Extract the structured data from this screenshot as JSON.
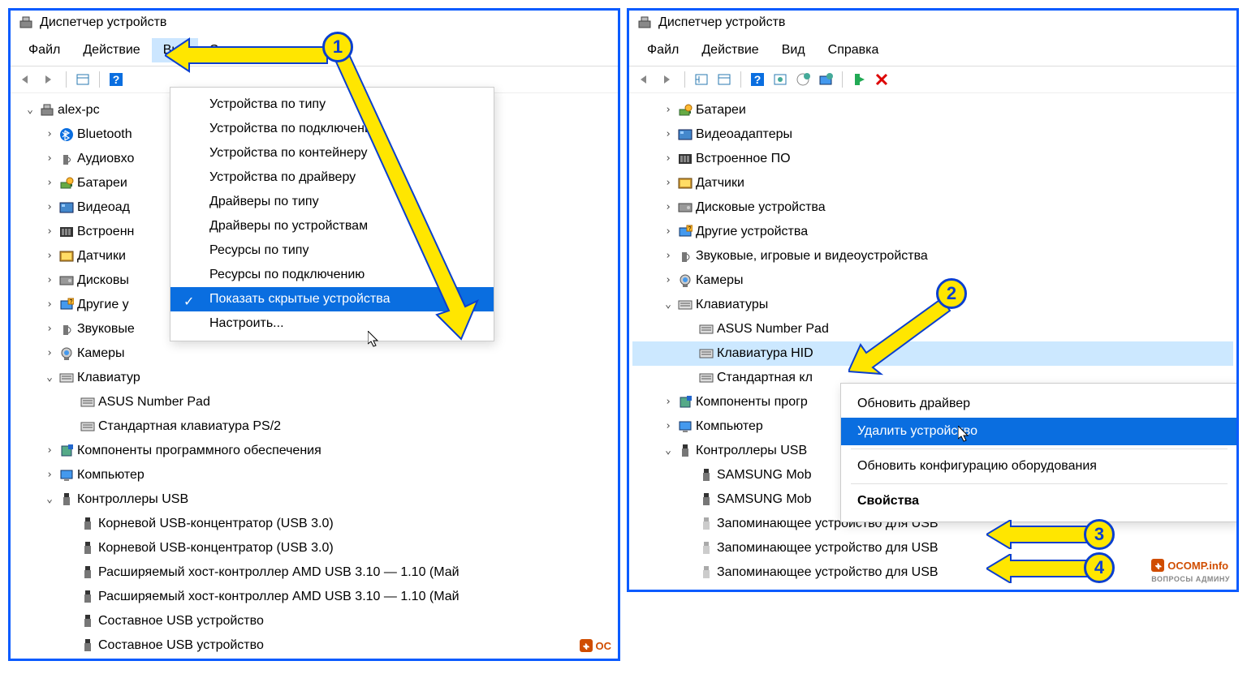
{
  "left": {
    "title": "Диспетчер устройств",
    "menu": {
      "file": "Файл",
      "action": "Действие",
      "view": "Вид",
      "help": "Справка"
    },
    "dropdown": {
      "items": [
        "Устройства по типу",
        "Устройства по подключению",
        "Устройства по контейнеру",
        "Устройства по драйверу",
        "Драйверы по типу",
        "Драйверы по устройствам",
        "Ресурсы по типу",
        "Ресурсы по подключению",
        "Показать скрытые устройства",
        "Настроить..."
      ],
      "selected": 8
    },
    "tree": {
      "root": "alex-pc",
      "items": [
        {
          "icon": "bluetooth",
          "label": "Bluetooth",
          "exp": ">"
        },
        {
          "icon": "audio-in",
          "label": "Аудиовхо",
          "exp": ">"
        },
        {
          "icon": "battery",
          "label": "Батареи",
          "exp": ">"
        },
        {
          "icon": "video",
          "label": "Видеоад",
          "exp": ">"
        },
        {
          "icon": "firmware",
          "label": "Встроенн",
          "exp": ">"
        },
        {
          "icon": "sensor",
          "label": "Датчики",
          "exp": ">"
        },
        {
          "icon": "disk",
          "label": "Дисковы",
          "exp": ">"
        },
        {
          "icon": "other",
          "label": "Другие у",
          "exp": ">"
        },
        {
          "icon": "sound",
          "label": "Звуковые",
          "exp": ">"
        },
        {
          "icon": "camera",
          "label": "Камеры",
          "exp": ">"
        }
      ],
      "keyboards": {
        "label": "Клавиатур",
        "children": [
          "ASUS Number Pad",
          "Стандартная клавиатура PS/2"
        ]
      },
      "software": "Компоненты программного обеспечения",
      "computer": "Компьютер",
      "usb": {
        "label": "Контроллеры USB",
        "children": [
          "Корневой USB-концентратор (USB 3.0)",
          "Корневой USB-концентратор (USB 3.0)",
          "Расширяемый хост-контроллер AMD USB 3.10 — 1.10 (Май",
          "Расширяемый хост-контроллер AMD USB 3.10 — 1.10 (Май",
          "Составное USB устройство",
          "Составное USB устройство"
        ]
      }
    }
  },
  "right": {
    "title": "Диспетчер устройств",
    "menu": {
      "file": "Файл",
      "action": "Действие",
      "view": "Вид",
      "help": "Справка"
    },
    "tree": {
      "items": [
        {
          "icon": "battery",
          "label": "Батареи",
          "exp": ">"
        },
        {
          "icon": "video",
          "label": "Видеоадаптеры",
          "exp": ">"
        },
        {
          "icon": "firmware",
          "label": "Встроенное ПО",
          "exp": ">"
        },
        {
          "icon": "sensor",
          "label": "Датчики",
          "exp": ">"
        },
        {
          "icon": "disk",
          "label": "Дисковые устройства",
          "exp": ">"
        },
        {
          "icon": "other",
          "label": "Другие устройства",
          "exp": ">"
        },
        {
          "icon": "sound",
          "label": "Звуковые, игровые и видеоустройства",
          "exp": ">"
        },
        {
          "icon": "camera",
          "label": "Камеры",
          "exp": ">"
        }
      ],
      "keyboards": {
        "label": "Клавиатуры",
        "children": [
          "ASUS Number Pad",
          "Клавиатура HID",
          "Стандартная кл"
        ],
        "selected": 1
      },
      "software": "Компоненты прогр",
      "computer": "Компьютер",
      "usb": {
        "label": "Контроллеры USB",
        "children": [
          "SAMSUNG Mob",
          "SAMSUNG Mob",
          "Запоминающее устройство для USB",
          "Запоминающее устройство для USB",
          "Запоминающее устройство для USB"
        ]
      }
    },
    "context": {
      "items": [
        "Обновить драйвер",
        "Удалить устройство",
        "Обновить конфигурацию оборудования",
        "Свойства"
      ],
      "selected": 1
    }
  },
  "badges": {
    "n1": "1",
    "n2": "2",
    "n3": "3",
    "n4": "4"
  },
  "watermark1": "OC",
  "watermark2": "OCOMP.info",
  "watermark_sub": "ВОПРОСЫ АДМИНУ"
}
